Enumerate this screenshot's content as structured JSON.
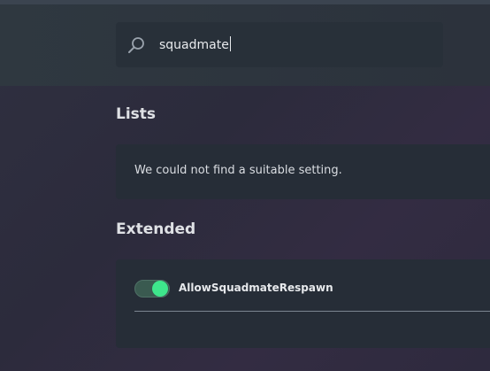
{
  "search": {
    "value": "squadmate",
    "icon": "search-icon"
  },
  "sections": {
    "lists": {
      "title": "Lists",
      "empty_message": "We could not find a suitable setting."
    },
    "extended": {
      "title": "Extended",
      "settings": [
        {
          "label": "AllowSquadmateRespawn",
          "enabled": true
        }
      ]
    }
  },
  "colors": {
    "toggle_on": "#3ee68c",
    "card_bg": "#262d37",
    "header_bg": "#2f3840"
  }
}
